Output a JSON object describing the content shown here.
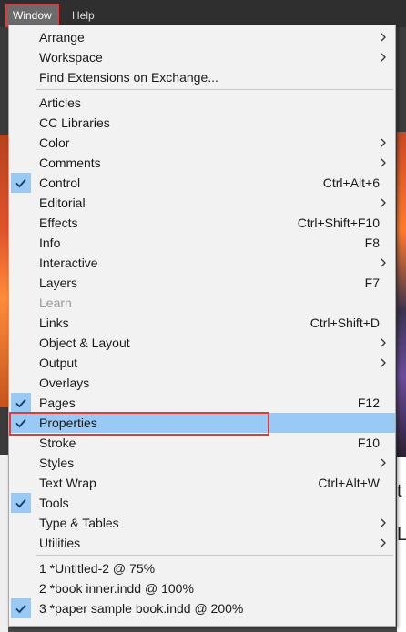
{
  "menubar": {
    "window_label": "Window",
    "help_label": "Help"
  },
  "background": {
    "right_doc_glyph_1": "t",
    "right_doc_glyph_2": "L"
  },
  "menu": {
    "groups": [
      [
        {
          "label": "Arrange",
          "submenu": true
        },
        {
          "label": "Workspace",
          "submenu": true
        },
        {
          "label": "Find Extensions on Exchange..."
        }
      ],
      [
        {
          "label": "Articles"
        },
        {
          "label": "CC Libraries"
        },
        {
          "label": "Color",
          "submenu": true
        },
        {
          "label": "Comments",
          "submenu": true
        },
        {
          "label": "Control",
          "shortcut": "Ctrl+Alt+6",
          "checked": true
        },
        {
          "label": "Editorial",
          "submenu": true
        },
        {
          "label": "Effects",
          "shortcut": "Ctrl+Shift+F10"
        },
        {
          "label": "Info",
          "shortcut": "F8"
        },
        {
          "label": "Interactive",
          "submenu": true
        },
        {
          "label": "Layers",
          "shortcut": "F7"
        },
        {
          "label": "Learn",
          "disabled": true
        },
        {
          "label": "Links",
          "shortcut": "Ctrl+Shift+D"
        },
        {
          "label": "Object & Layout",
          "submenu": true
        },
        {
          "label": "Output",
          "submenu": true
        },
        {
          "label": "Overlays"
        },
        {
          "label": "Pages",
          "shortcut": "F12",
          "checked": true
        },
        {
          "label": "Properties",
          "checked": true,
          "highlighted": true
        },
        {
          "label": "Stroke",
          "shortcut": "F10"
        },
        {
          "label": "Styles",
          "submenu": true
        },
        {
          "label": "Text Wrap",
          "shortcut": "Ctrl+Alt+W"
        },
        {
          "label": "Tools",
          "checked": true
        },
        {
          "label": "Type & Tables",
          "submenu": true
        },
        {
          "label": "Utilities",
          "submenu": true
        }
      ],
      [
        {
          "label": "1 *Untitled-2 @ 75%"
        },
        {
          "label": "2 *book inner.indd @ 100%"
        },
        {
          "label": "3 *paper sample book.indd @ 200%",
          "checked": true
        }
      ]
    ]
  },
  "colors": {
    "highlight": "#99c9f5",
    "annotation_red": "#e03b3b",
    "menu_bg": "#f2f2f2"
  }
}
